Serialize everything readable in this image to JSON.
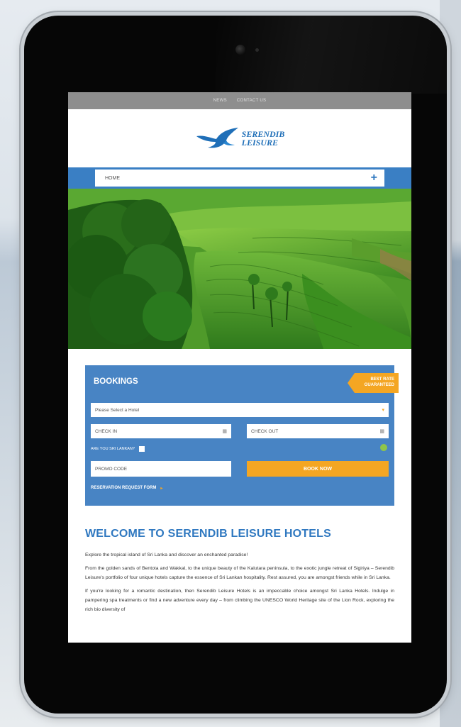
{
  "topbar": {
    "links": [
      "NEWS",
      "CONTACT US"
    ]
  },
  "brand": {
    "line1": "SERENDIB",
    "line2": "LEISURE",
    "color": "#1f6fb8"
  },
  "nav": {
    "home_label": "HOME",
    "expand_icon": "plus-icon"
  },
  "booking": {
    "title": "BOOKINGS",
    "badge_line1": "BEST RATE",
    "badge_line2": "GUARANTEED",
    "hotel_select": "Please Select a Hotel",
    "check_in": "CHECK IN",
    "check_out": "CHECK OUT",
    "sri_lankan_label": "ARE YOU SRI LANKAN?",
    "promo_placeholder": "PROMO CODE",
    "book_now": "BOOK NOW",
    "reservation_link": "RESERVATION REQUEST FORM",
    "panel_color": "#4884c4",
    "accent_color": "#f4a623"
  },
  "content": {
    "heading": "WELCOME TO SERENDIB LEISURE HOTELS",
    "intro": "Explore the tropical island of Sri Lanka and discover an enchanted paradise!",
    "para1": "From the golden sands of Bentota and Wakkal, to the unique beauty of the Kalutara peninsula, to the exotic jungle retreat of Sigiriya – Serendib Leisure's portfolio of four unique hotels capture the essence of Sri Lankan hospitality. Rest assured, you are amongst friends while in Sri Lanka.",
    "para2": "If you're looking for a romantic destination, then Serendib Leisure Hotels is an impeccable choice amongst Sri Lanka Hotels. Indulge in pampering spa treatments or find a new adventure every day – from climbing the UNESCO World Heritage site of the Lion Rock, exploring the rich bio diversity of"
  }
}
